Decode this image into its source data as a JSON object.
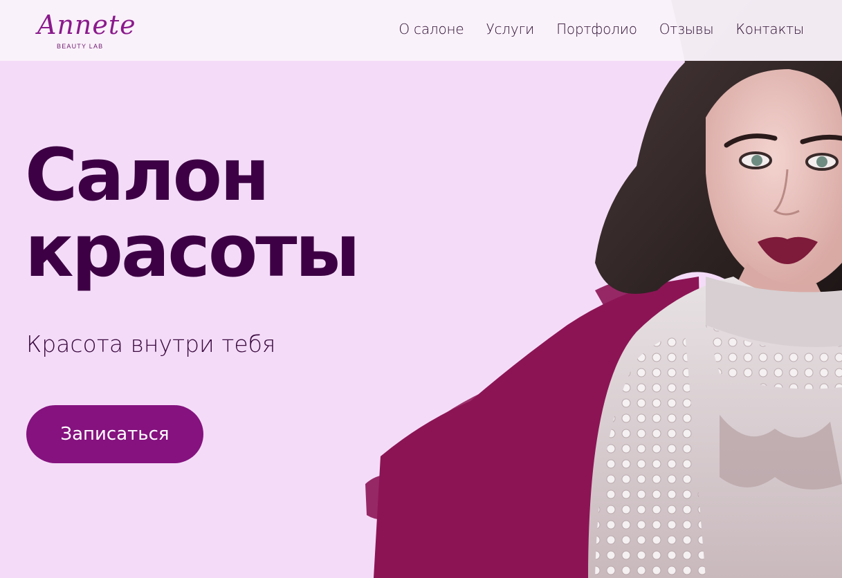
{
  "header": {
    "logo_script": "Annete",
    "logo_sub": "BEAUTY LAB",
    "nav": [
      "О салоне",
      "Услуги",
      "Портфолио",
      "Отзывы",
      "Контакты"
    ]
  },
  "hero": {
    "title_line1": "Салон",
    "title_line2": "красоты",
    "subtitle": "Красота внутри тебя",
    "cta_label": "Записаться",
    "image_subject": "woman-portrait"
  },
  "colors": {
    "background": "#f4dcf8",
    "title": "#3d0044",
    "button": "#85127f",
    "brush": "#8c1455",
    "logo": "#8a1a8c"
  }
}
